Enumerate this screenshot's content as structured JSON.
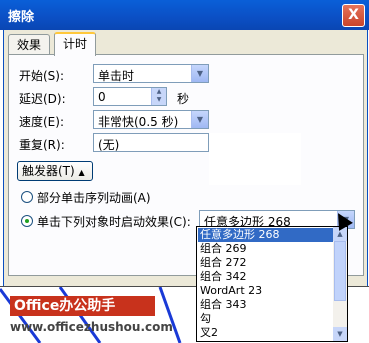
{
  "window": {
    "title": "擦除",
    "close_glyph": "X"
  },
  "tabs": [
    {
      "label": "效果"
    },
    {
      "label": "计时"
    }
  ],
  "fields": {
    "start": {
      "label": "开始(S):",
      "value": "单击时"
    },
    "delay": {
      "label": "延迟(D):",
      "value": "0",
      "unit": "秒"
    },
    "speed": {
      "label": "速度(E):",
      "value": "非常快(0.5 秒)"
    },
    "repeat": {
      "label": "重复(R):",
      "value": "(无)"
    }
  },
  "trigger_button": {
    "label": "触发器(T)",
    "glyph": "▲"
  },
  "radios": [
    {
      "label": "部分单击序列动画(A)",
      "checked": false
    },
    {
      "label": "单击下列对象时启动效果(C):",
      "checked": true
    }
  ],
  "object_combo": {
    "value": "任意多边形 268"
  },
  "object_list": [
    {
      "label": "任意多边形 268",
      "selected": true
    },
    {
      "label": "组合 269"
    },
    {
      "label": "组合 272"
    },
    {
      "label": "组合 342"
    },
    {
      "label": "WordArt 23"
    },
    {
      "label": "组合 343"
    },
    {
      "label": "勾"
    },
    {
      "label": "叉2"
    }
  ],
  "watermark": {
    "brand": "Office办公助手",
    "url": "www.officezhushou.com"
  },
  "colors": {
    "titlebar": "#0b4fc4",
    "selection": "#316ac5",
    "logo": "#c8321c"
  }
}
